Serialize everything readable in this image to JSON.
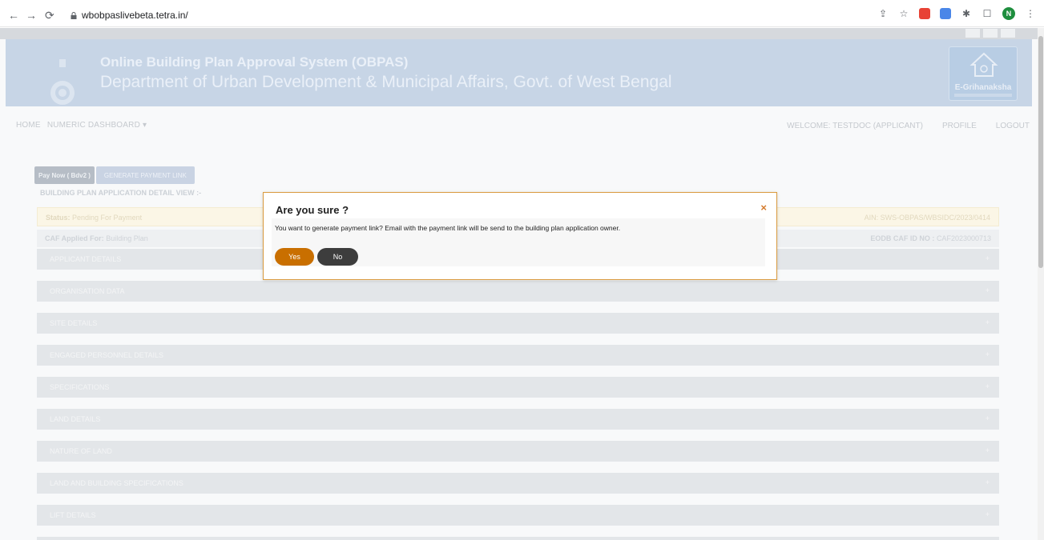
{
  "browser": {
    "url": "wbobpaslivebeta.tetra.in/",
    "profile_initial": "N"
  },
  "header": {
    "title": "Online Building Plan Approval System (OBPAS)",
    "subtitle": "Department of Urban Development & Municipal Affairs, Govt. of West Bengal",
    "logo_text": "E-Grihanaksha"
  },
  "nav": {
    "home": "HOME",
    "dashboard": "NUMERIC DASHBOARD ▾",
    "welcome": "WELCOME: TESTDOC (APPLICANT)",
    "profile": "PROFILE",
    "logout": "LOGOUT"
  },
  "actions": {
    "pay_now": "Pay Now ( Bdv2 )",
    "generate_link": "GENERATE PAYMENT LINK"
  },
  "detail": {
    "title": "BUILDING PLAN APPLICATION DETAIL VIEW :-",
    "status_label": "Status:",
    "status_value": "Pending For Payment",
    "ain_label": "AIN:",
    "ain_value": "SWS-OBPAS/WBSIDC/2023/0414",
    "caf_label": "CAF Applied For:",
    "caf_value": "Building Plan",
    "eodb_label": "EODB CAF ID NO :",
    "eodb_value": "CAF2023000713"
  },
  "sections": [
    "APPLICANT DETAILS",
    "ORGANISATION DATA",
    "SITE DETAILS",
    "ENGAGED PERSONNEL DETAILS",
    "SPECIFICATIONS",
    "LAND DETAILS",
    "NATURE OF LAND",
    "LAND AND BUILDING SPECIFICATIONS",
    "LIFT DETAILS"
  ],
  "modal": {
    "title": "Are you sure ?",
    "message": "You want to generate payment link? Email with the payment link will be send to the building plan application owner.",
    "yes": "Yes",
    "no": "No",
    "close": "×"
  },
  "colors": {
    "modal_border": "#d99a3f",
    "yes_button": "#c96f00",
    "no_button": "#3d3d3d",
    "header_bg": "#c7d5e6"
  }
}
